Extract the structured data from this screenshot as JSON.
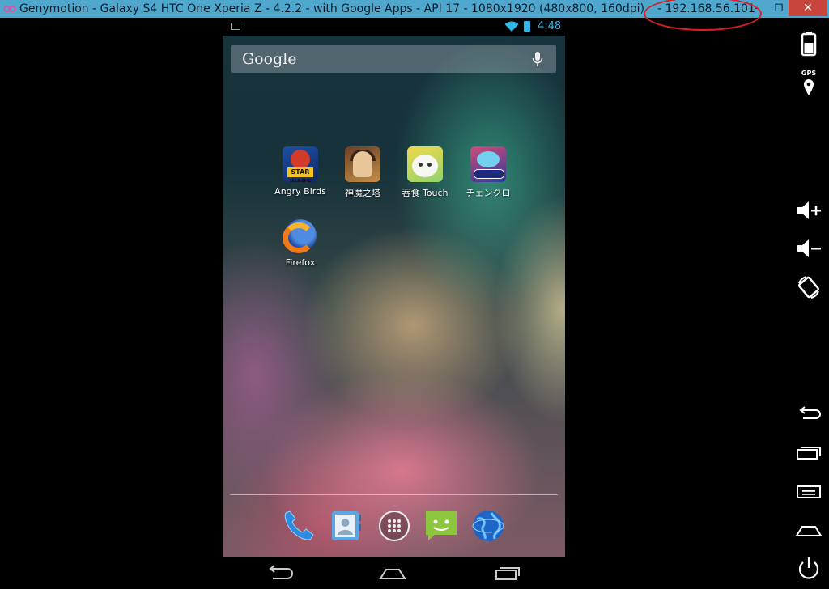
{
  "window": {
    "title": "Genymotion - Galaxy S4  HTC One  Xperia Z - 4.2.2 - with Google Apps - API 17 - 1080x1920 (480x800, 160dpi)",
    "ip_address": "- 192.168.56.101",
    "minimize_label": "–",
    "restore_label": "❐",
    "close_label": "✕"
  },
  "status_bar": {
    "time": "4:48"
  },
  "search": {
    "logo": "Google"
  },
  "apps": [
    {
      "label": "Angry Birds",
      "badge": "STAR WARS"
    },
    {
      "label": "神魔之塔"
    },
    {
      "label": "吞食 Touch"
    },
    {
      "label": "チェンクロ"
    },
    {
      "label": "Firefox"
    }
  ],
  "sidebar": {
    "gps_label": "GPS"
  },
  "colors": {
    "titlebar": "#4fa7cd",
    "accent_blue": "#33b5e5",
    "highlight_ring": "#d8202b",
    "close_button": "#c7453c"
  }
}
